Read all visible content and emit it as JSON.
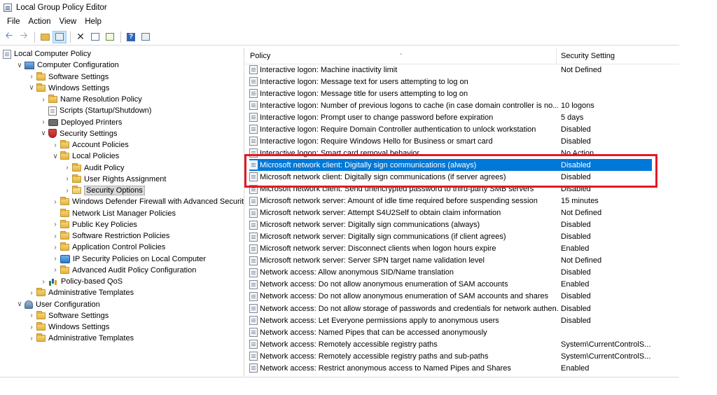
{
  "window": {
    "title": "Local Group Policy Editor"
  },
  "menu": [
    "File",
    "Action",
    "View",
    "Help"
  ],
  "toolbar": {
    "icons": [
      "back-arrow-icon",
      "forward-arrow-icon",
      "up-folder-icon",
      "show-hide-tree-icon",
      "delete-icon",
      "properties-icon",
      "export-list-icon",
      "help-icon",
      "extended-view-icon"
    ]
  },
  "tree": [
    {
      "label": "Local Computer Policy",
      "indent": 0,
      "twisty": "",
      "icon": "policy"
    },
    {
      "label": "Computer Configuration",
      "indent": 1,
      "twisty": "open",
      "icon": "computer"
    },
    {
      "label": "Software Settings",
      "indent": 2,
      "twisty": "closed",
      "icon": "folder"
    },
    {
      "label": "Windows Settings",
      "indent": 2,
      "twisty": "open",
      "icon": "folder"
    },
    {
      "label": "Name Resolution Policy",
      "indent": 3,
      "twisty": "closed",
      "icon": "folder"
    },
    {
      "label": "Scripts (Startup/Shutdown)",
      "indent": 3,
      "twisty": "",
      "icon": "doc"
    },
    {
      "label": "Deployed Printers",
      "indent": 3,
      "twisty": "closed",
      "icon": "printer"
    },
    {
      "label": "Security Settings",
      "indent": 3,
      "twisty": "open",
      "icon": "shield"
    },
    {
      "label": "Account Policies",
      "indent": 4,
      "twisty": "closed",
      "icon": "folder"
    },
    {
      "label": "Local Policies",
      "indent": 4,
      "twisty": "open",
      "icon": "folder"
    },
    {
      "label": "Audit Policy",
      "indent": 5,
      "twisty": "closed",
      "icon": "folder"
    },
    {
      "label": "User Rights Assignment",
      "indent": 5,
      "twisty": "closed",
      "icon": "folder"
    },
    {
      "label": "Security Options",
      "indent": 5,
      "twisty": "closed",
      "icon": "folder-open",
      "selected": true
    },
    {
      "label": "Windows Defender Firewall with Advanced Security",
      "indent": 4,
      "twisty": "closed",
      "icon": "folder"
    },
    {
      "label": "Network List Manager Policies",
      "indent": 4,
      "twisty": "",
      "icon": "folder"
    },
    {
      "label": "Public Key Policies",
      "indent": 4,
      "twisty": "closed",
      "icon": "folder"
    },
    {
      "label": "Software Restriction Policies",
      "indent": 4,
      "twisty": "closed",
      "icon": "folder"
    },
    {
      "label": "Application Control Policies",
      "indent": 4,
      "twisty": "closed",
      "icon": "folder"
    },
    {
      "label": "IP Security Policies on Local Computer",
      "indent": 4,
      "twisty": "closed",
      "icon": "net"
    },
    {
      "label": "Advanced Audit Policy Configuration",
      "indent": 4,
      "twisty": "closed",
      "icon": "folder"
    },
    {
      "label": "Policy-based QoS",
      "indent": 3,
      "twisty": "closed",
      "icon": "chart"
    },
    {
      "label": "Administrative Templates",
      "indent": 2,
      "twisty": "closed",
      "icon": "folder"
    },
    {
      "label": "User Configuration",
      "indent": 1,
      "twisty": "open",
      "icon": "user"
    },
    {
      "label": "Software Settings",
      "indent": 2,
      "twisty": "closed",
      "icon": "folder"
    },
    {
      "label": "Windows Settings",
      "indent": 2,
      "twisty": "closed",
      "icon": "folder"
    },
    {
      "label": "Administrative Templates",
      "indent": 2,
      "twisty": "closed",
      "icon": "folder"
    }
  ],
  "list": {
    "columns": {
      "policy": "Policy",
      "setting": "Security Setting"
    },
    "rows": [
      {
        "policy": "Interactive logon: Machine inactivity limit",
        "setting": "Not Defined"
      },
      {
        "policy": "Interactive logon: Message text for users attempting to log on",
        "setting": ""
      },
      {
        "policy": "Interactive logon: Message title for users attempting to log on",
        "setting": ""
      },
      {
        "policy": "Interactive logon: Number of previous logons to cache (in case domain controller is no...",
        "setting": "10 logons"
      },
      {
        "policy": "Interactive logon: Prompt user to change password before expiration",
        "setting": "5 days"
      },
      {
        "policy": "Interactive logon: Require Domain Controller authentication to unlock workstation",
        "setting": "Disabled"
      },
      {
        "policy": "Interactive logon: Require Windows Hello for Business or smart card",
        "setting": "Disabled"
      },
      {
        "policy": "Interactive logon: Smart card removal behavior",
        "setting": "No Action"
      },
      {
        "policy": "Microsoft network client: Digitally sign communications (always)",
        "setting": "Disabled",
        "selected": true
      },
      {
        "policy": "Microsoft network client: Digitally sign communications (if server agrees)",
        "setting": "Disabled"
      },
      {
        "policy": "Microsoft network client: Send unencrypted password to third-party SMB servers",
        "setting": "Disabled"
      },
      {
        "policy": "Microsoft network server: Amount of idle time required before suspending session",
        "setting": "15 minutes"
      },
      {
        "policy": "Microsoft network server: Attempt S4U2Self to obtain claim information",
        "setting": "Not Defined"
      },
      {
        "policy": "Microsoft network server: Digitally sign communications (always)",
        "setting": "Disabled"
      },
      {
        "policy": "Microsoft network server: Digitally sign communications (if client agrees)",
        "setting": "Disabled"
      },
      {
        "policy": "Microsoft network server: Disconnect clients when logon hours expire",
        "setting": "Enabled"
      },
      {
        "policy": "Microsoft network server: Server SPN target name validation level",
        "setting": "Not Defined"
      },
      {
        "policy": "Network access: Allow anonymous SID/Name translation",
        "setting": "Disabled"
      },
      {
        "policy": "Network access: Do not allow anonymous enumeration of SAM accounts",
        "setting": "Enabled"
      },
      {
        "policy": "Network access: Do not allow anonymous enumeration of SAM accounts and shares",
        "setting": "Disabled"
      },
      {
        "policy": "Network access: Do not allow storage of passwords and credentials for network authen...",
        "setting": "Disabled"
      },
      {
        "policy": "Network access: Let Everyone permissions apply to anonymous users",
        "setting": "Disabled"
      },
      {
        "policy": "Network access: Named Pipes that can be accessed anonymously",
        "setting": ""
      },
      {
        "policy": "Network access: Remotely accessible registry paths",
        "setting": "System\\CurrentControlS..."
      },
      {
        "policy": "Network access: Remotely accessible registry paths and sub-paths",
        "setting": "System\\CurrentControlS..."
      },
      {
        "policy": "Network access: Restrict anonymous access to Named Pipes and Shares",
        "setting": "Enabled"
      }
    ]
  },
  "colors": {
    "selection": "#0078d7",
    "highlight_border": "#e21a23"
  }
}
